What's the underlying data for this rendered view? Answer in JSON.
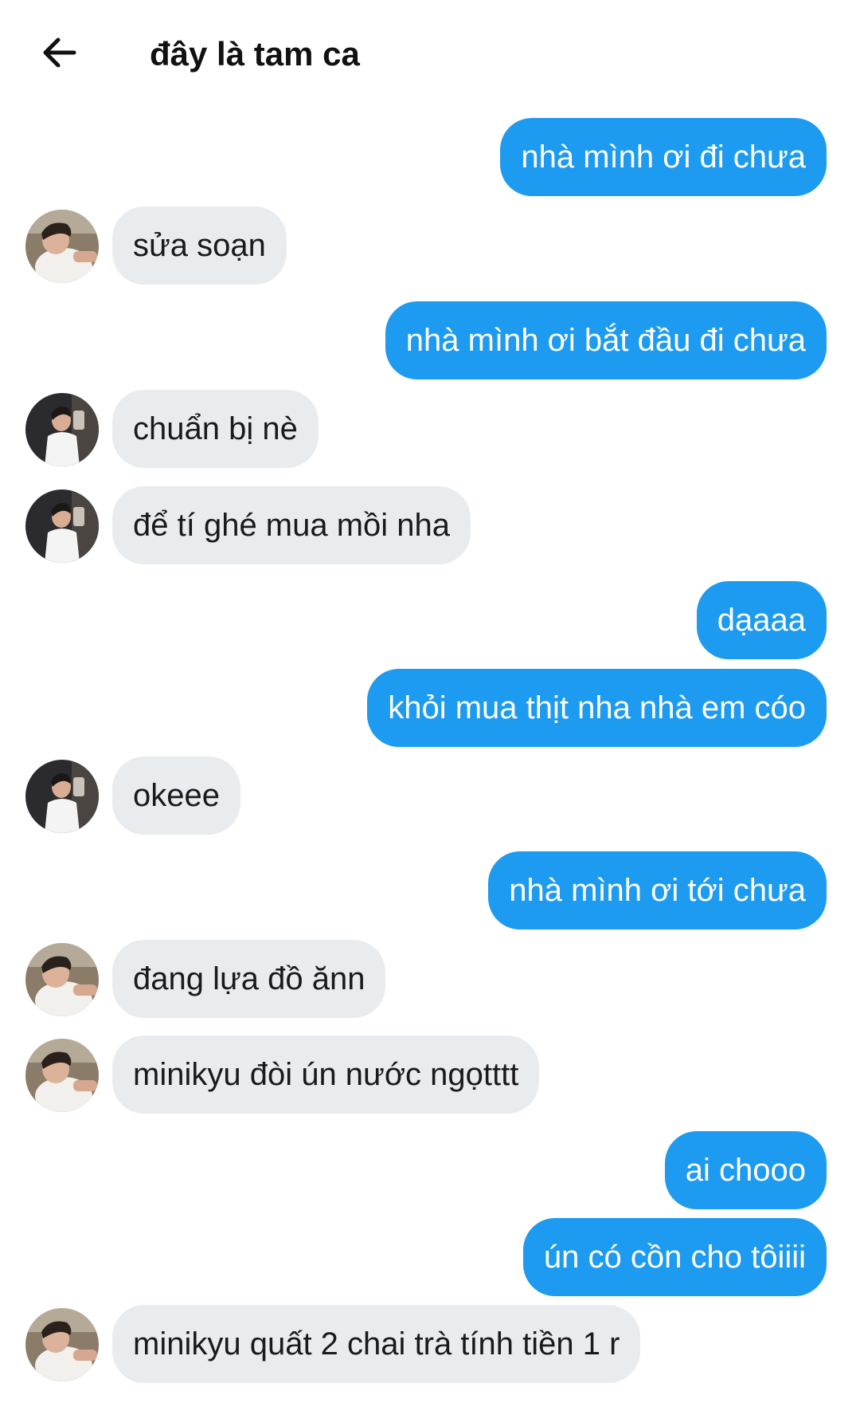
{
  "header": {
    "back_icon": "arrow-left-icon",
    "title": "đây là tam ca"
  },
  "colors": {
    "sent_bubble": "#1d9bf0",
    "received_bubble": "#e9ecef",
    "sent_text": "#ffffff",
    "received_text": "#1a1a1a"
  },
  "messages": [
    {
      "direction": "sent",
      "text": "nhà mình ơi đi chưa"
    },
    {
      "direction": "received",
      "text": "sửa soạn",
      "avatar": "avatar-a"
    },
    {
      "direction": "sent",
      "text": "nhà mình ơi bắt đầu đi chưa"
    },
    {
      "direction": "received",
      "text": "chuẩn bị nè",
      "avatar": "avatar-b"
    },
    {
      "direction": "received",
      "text": "để tí ghé mua mồi nha",
      "avatar": "avatar-b"
    },
    {
      "direction": "sent",
      "text": "dạaaa"
    },
    {
      "direction": "sent",
      "text": "khỏi mua thịt nha nhà em cóo"
    },
    {
      "direction": "received",
      "text": "okeee",
      "avatar": "avatar-b"
    },
    {
      "direction": "sent",
      "text": "nhà mình ơi tới chưa"
    },
    {
      "direction": "received",
      "text": "đang lựa đồ ănn",
      "avatar": "avatar-a"
    },
    {
      "direction": "received",
      "text": "minikyu đòi ún nước ngọtttt",
      "avatar": "avatar-a"
    },
    {
      "direction": "sent",
      "text": "ai chooo"
    },
    {
      "direction": "sent",
      "text": "ún có cồn cho tôiiii"
    },
    {
      "direction": "received",
      "text": "minikyu quất 2 chai trà tính tiền 1 r",
      "avatar": "avatar-a"
    }
  ]
}
